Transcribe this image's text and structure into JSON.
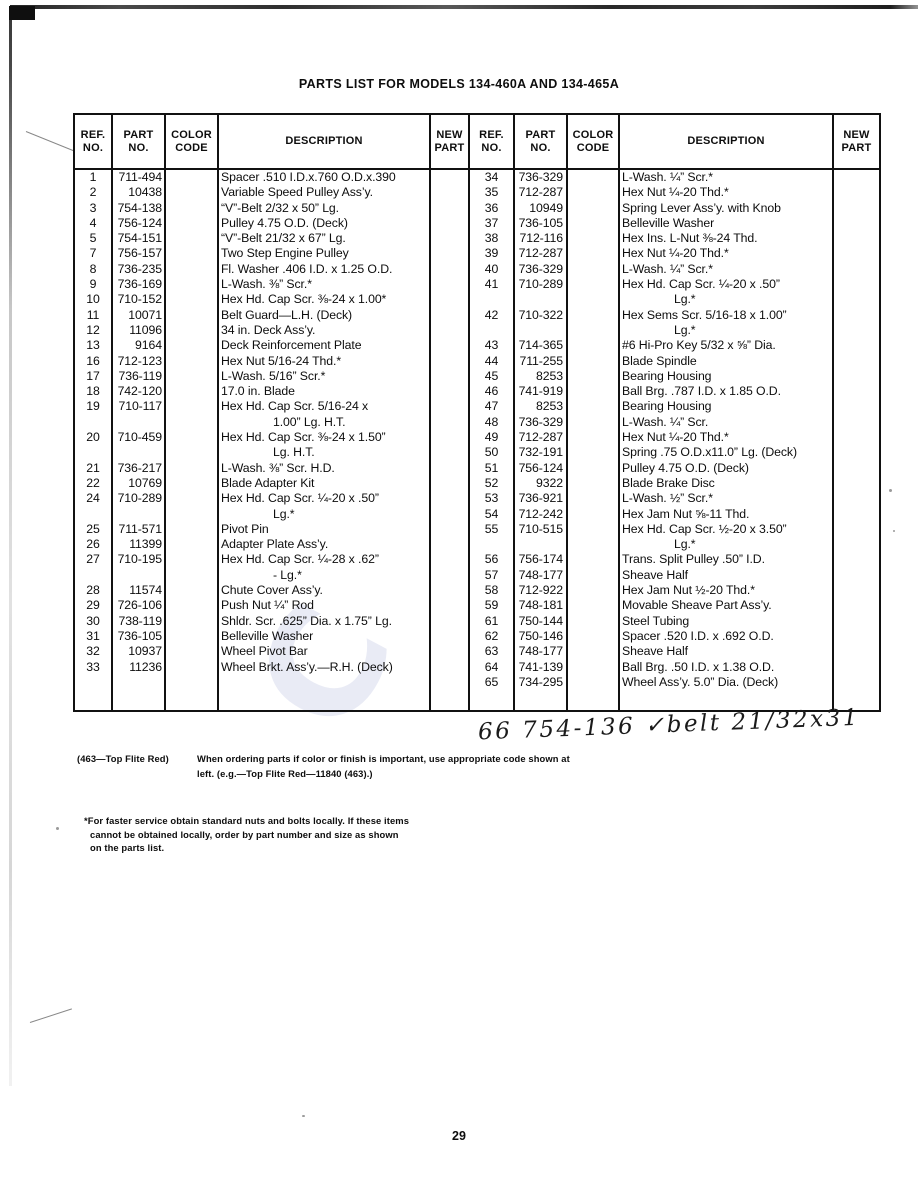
{
  "document": {
    "title": "PARTS LIST FOR MODELS 134-460A AND 134-465A",
    "page_number": "29"
  },
  "watermark": {
    "text": "C"
  },
  "table": {
    "headers": {
      "ref_no": "REF.\nNO.",
      "ref_no_l1": "REF.",
      "ref_no_l2": "NO.",
      "part_no_l1": "PART",
      "part_no_l2": "NO.",
      "color_code_l1": "COLOR",
      "color_code_l2": "CODE",
      "description": "DESCRIPTION",
      "new_part_l1": "NEW",
      "new_part_l2": "PART"
    },
    "left_rows": [
      {
        "ref": "1",
        "part": "711-494",
        "color": "",
        "desc": "Spacer .510 I.D.x.760 O.D.x.390",
        "desc2": "",
        "new": ""
      },
      {
        "ref": "2",
        "part": "10438",
        "color": "",
        "desc": "Variable Speed Pulley Ass’y.",
        "desc2": "",
        "new": ""
      },
      {
        "ref": "3",
        "part": "754-138",
        "color": "",
        "desc": "“V”-Belt 2/32 x 50” Lg.",
        "desc2": "",
        "new": ""
      },
      {
        "ref": "4",
        "part": "756-124",
        "color": "",
        "desc": "Pulley 4.75 O.D. (Deck)",
        "desc2": "",
        "new": ""
      },
      {
        "ref": "5",
        "part": "754-151",
        "color": "",
        "desc": "“V”-Belt 21/32 x 67” Lg.",
        "desc2": "",
        "new": ""
      },
      {
        "ref": "7",
        "part": "756-157",
        "color": "",
        "desc": "Two Step Engine Pulley",
        "desc2": "",
        "new": ""
      },
      {
        "ref": "8",
        "part": "736-235",
        "color": "",
        "desc": "Fl. Washer .406 I.D. x 1.25 O.D.",
        "desc2": "",
        "new": ""
      },
      {
        "ref": "9",
        "part": "736-169",
        "color": "",
        "desc": "L-Wash. ⅜” Scr.*",
        "desc2": "",
        "new": ""
      },
      {
        "ref": "10",
        "part": "710-152",
        "color": "",
        "desc": "Hex Hd. Cap Scr. ⅜-24 x 1.00*",
        "desc2": "",
        "new": ""
      },
      {
        "ref": "11",
        "part": "10071",
        "color": "",
        "desc": "Belt Guard—L.H. (Deck)",
        "desc2": "",
        "new": ""
      },
      {
        "ref": "12",
        "part": "11096",
        "color": "",
        "desc": "34 in. Deck Ass’y.",
        "desc2": "",
        "new": ""
      },
      {
        "ref": "13",
        "part": "9164",
        "color": "",
        "desc": "Deck Reinforcement Plate",
        "desc2": "",
        "new": ""
      },
      {
        "ref": "16",
        "part": "712-123",
        "color": "",
        "desc": "Hex Nut 5/16-24 Thd.*",
        "desc2": "",
        "new": ""
      },
      {
        "ref": "17",
        "part": "736-119",
        "color": "",
        "desc": "L-Wash. 5/16” Scr.*",
        "desc2": "",
        "new": ""
      },
      {
        "ref": "18",
        "part": "742-120",
        "color": "",
        "desc": "17.0 in. Blade",
        "desc2": "",
        "new": ""
      },
      {
        "ref": "19",
        "part": "710-117",
        "color": "",
        "desc": "Hex Hd. Cap Scr. 5/16-24 x",
        "desc2": "1.00” Lg. H.T.",
        "new": ""
      },
      {
        "ref": "20",
        "part": "710-459",
        "color": "",
        "desc": "Hex Hd. Cap Scr. ⅜-24 x 1.50”",
        "desc2": "Lg. H.T.",
        "new": ""
      },
      {
        "ref": "21",
        "part": "736-217",
        "color": "",
        "desc": "L-Wash. ⅜” Scr. H.D.",
        "desc2": "",
        "new": ""
      },
      {
        "ref": "22",
        "part": "10769",
        "color": "",
        "desc": "Blade Adapter Kit",
        "desc2": "",
        "new": ""
      },
      {
        "ref": "24",
        "part": "710-289",
        "color": "",
        "desc": "Hex Hd. Cap Scr. ¼-20 x .50”",
        "desc2": "Lg.*",
        "new": ""
      },
      {
        "ref": "25",
        "part": "711-571",
        "color": "",
        "desc": "Pivot Pin",
        "desc2": "",
        "new": ""
      },
      {
        "ref": "26",
        "part": "11399",
        "color": "",
        "desc": "Adapter Plate Ass’y.",
        "desc2": "",
        "new": ""
      },
      {
        "ref": "27",
        "part": "710-195",
        "color": "",
        "desc": "Hex Hd. Cap Scr. ¼-28 x .62”",
        "desc2": "-  Lg.*",
        "new": ""
      },
      {
        "ref": "28",
        "part": "11574",
        "color": "",
        "desc": "Chute Cover Ass’y.",
        "desc2": "",
        "new": ""
      },
      {
        "ref": "29",
        "part": "726-106",
        "color": "",
        "desc": "Push Nut ¼” Rod",
        "desc2": "",
        "new": ""
      },
      {
        "ref": "30",
        "part": "738-119",
        "color": "",
        "desc": "Shldr. Scr. .625” Dia. x 1.75” Lg.",
        "desc2": "",
        "new": ""
      },
      {
        "ref": "31",
        "part": "736-105",
        "color": "",
        "desc": "Belleville Washer",
        "desc2": "",
        "new": ""
      },
      {
        "ref": "32",
        "part": "10937",
        "color": "",
        "desc": "Wheel Pivot Bar",
        "desc2": "",
        "new": ""
      },
      {
        "ref": "33",
        "part": "11236",
        "color": "",
        "desc": "Wheel Brkt. Ass’y.—R.H. (Deck)",
        "desc2": "",
        "new": ""
      }
    ],
    "right_rows": [
      {
        "ref": "34",
        "part": "736-329",
        "color": "",
        "desc": "L-Wash. ¼” Scr.*",
        "desc2": "",
        "new": ""
      },
      {
        "ref": "35",
        "part": "712-287",
        "color": "",
        "desc": "Hex Nut ¼-20 Thd.*",
        "desc2": "",
        "new": ""
      },
      {
        "ref": "36",
        "part": "10949",
        "color": "",
        "desc": "Spring Lever Ass’y. with Knob",
        "desc2": "",
        "new": ""
      },
      {
        "ref": "37",
        "part": "736-105",
        "color": "",
        "desc": "Belleville Washer",
        "desc2": "",
        "new": ""
      },
      {
        "ref": "38",
        "part": "712-116",
        "color": "",
        "desc": "Hex Ins. L-Nut ⅜-24 Thd.",
        "desc2": "",
        "new": ""
      },
      {
        "ref": "39",
        "part": "712-287",
        "color": "",
        "desc": "Hex Nut ¼-20 Thd.*",
        "desc2": "",
        "new": ""
      },
      {
        "ref": "40",
        "part": "736-329",
        "color": "",
        "desc": "L-Wash. ¼” Scr.*",
        "desc2": "",
        "new": ""
      },
      {
        "ref": "41",
        "part": "710-289",
        "color": "",
        "desc": "Hex Hd. Cap Scr. ¼-20 x .50”",
        "desc2": "Lg.*",
        "new": ""
      },
      {
        "ref": "42",
        "part": "710-322",
        "color": "",
        "desc": "Hex Sems Scr. 5/16-18 x 1.00”",
        "desc2": "Lg.*",
        "new": ""
      },
      {
        "ref": "43",
        "part": "714-365",
        "color": "",
        "desc": "#6 Hi-Pro Key 5/32 x ⅝” Dia.",
        "desc2": "",
        "new": ""
      },
      {
        "ref": "44",
        "part": "711-255",
        "color": "",
        "desc": "Blade Spindle",
        "desc2": "",
        "new": ""
      },
      {
        "ref": "45",
        "part": "8253",
        "color": "",
        "desc": "Bearing Housing",
        "desc2": "",
        "new": ""
      },
      {
        "ref": "46",
        "part": "741-919",
        "color": "",
        "desc": "Ball Brg. .787 I.D. x 1.85 O.D.",
        "desc2": "",
        "new": ""
      },
      {
        "ref": "47",
        "part": "8253",
        "color": "",
        "desc": "Bearing Housing",
        "desc2": "",
        "new": ""
      },
      {
        "ref": "48",
        "part": "736-329",
        "color": "",
        "desc": "L-Wash. ¼” Scr.",
        "desc2": "",
        "new": ""
      },
      {
        "ref": "49",
        "part": "712-287",
        "color": "",
        "desc": "Hex Nut ¼-20 Thd.*",
        "desc2": "",
        "new": ""
      },
      {
        "ref": "50",
        "part": "732-191",
        "color": "",
        "desc": "Spring .75 O.D.x11.0” Lg. (Deck)",
        "desc2": "",
        "new": ""
      },
      {
        "ref": "51",
        "part": "756-124",
        "color": "",
        "desc": "Pulley 4.75 O.D. (Deck)",
        "desc2": "",
        "new": ""
      },
      {
        "ref": "52",
        "part": "9322",
        "color": "",
        "desc": "Blade Brake Disc",
        "desc2": "",
        "new": ""
      },
      {
        "ref": "53",
        "part": "736-921",
        "color": "",
        "desc": "L-Wash. ½” Scr.*",
        "desc2": "",
        "new": ""
      },
      {
        "ref": "54",
        "part": "712-242",
        "color": "",
        "desc": "Hex Jam Nut ⅝-11 Thd.",
        "desc2": "",
        "new": ""
      },
      {
        "ref": "55",
        "part": "710-515",
        "color": "",
        "desc": "Hex Hd. Cap Scr. ½-20 x 3.50”",
        "desc2": "Lg.*",
        "new": ""
      },
      {
        "ref": "56",
        "part": "756-174",
        "color": "",
        "desc": "Trans. Split Pulley .50” I.D.",
        "desc2": "",
        "new": ""
      },
      {
        "ref": "57",
        "part": "748-177",
        "color": "",
        "desc": "Sheave Half",
        "desc2": "",
        "new": ""
      },
      {
        "ref": "58",
        "part": "712-922",
        "color": "",
        "desc": "Hex Jam Nut ½-20 Thd.*",
        "desc2": "",
        "new": ""
      },
      {
        "ref": "59",
        "part": "748-181",
        "color": "",
        "desc": "Movable Sheave Part Ass’y.",
        "desc2": "",
        "new": ""
      },
      {
        "ref": "61",
        "part": "750-144",
        "color": "",
        "desc": "Steel Tubing",
        "desc2": "",
        "new": ""
      },
      {
        "ref": "62",
        "part": "750-146",
        "color": "",
        "desc": "Spacer .520 I.D. x .692 O.D.",
        "desc2": "",
        "new": ""
      },
      {
        "ref": "63",
        "part": "748-177",
        "color": "",
        "desc": "Sheave Half",
        "desc2": "",
        "new": ""
      },
      {
        "ref": "64",
        "part": "741-139",
        "color": "",
        "desc": "Ball Brg. .50 I.D. x 1.38 O.D.",
        "desc2": "",
        "new": ""
      },
      {
        "ref": "65",
        "part": "734-295",
        "color": "",
        "desc": "Wheel Ass’y. 5.0” Dia. (Deck)",
        "desc2": "",
        "new": ""
      }
    ]
  },
  "handwritten_note": "66 754-136 ✓belt 21/32x31",
  "color_note": {
    "code_label": "(463—Top Flite Red)",
    "line1": "When ordering parts if color or finish is important, use appropriate code shown at",
    "line2": "left. (e.g.—Top Flite Red—11840 (463).)"
  },
  "service_note": {
    "line1": "*For faster service obtain standard nuts and bolts locally. If these items",
    "line2": "cannot be obtained locally, order by part number and size as shown",
    "line3": "on the parts list."
  }
}
